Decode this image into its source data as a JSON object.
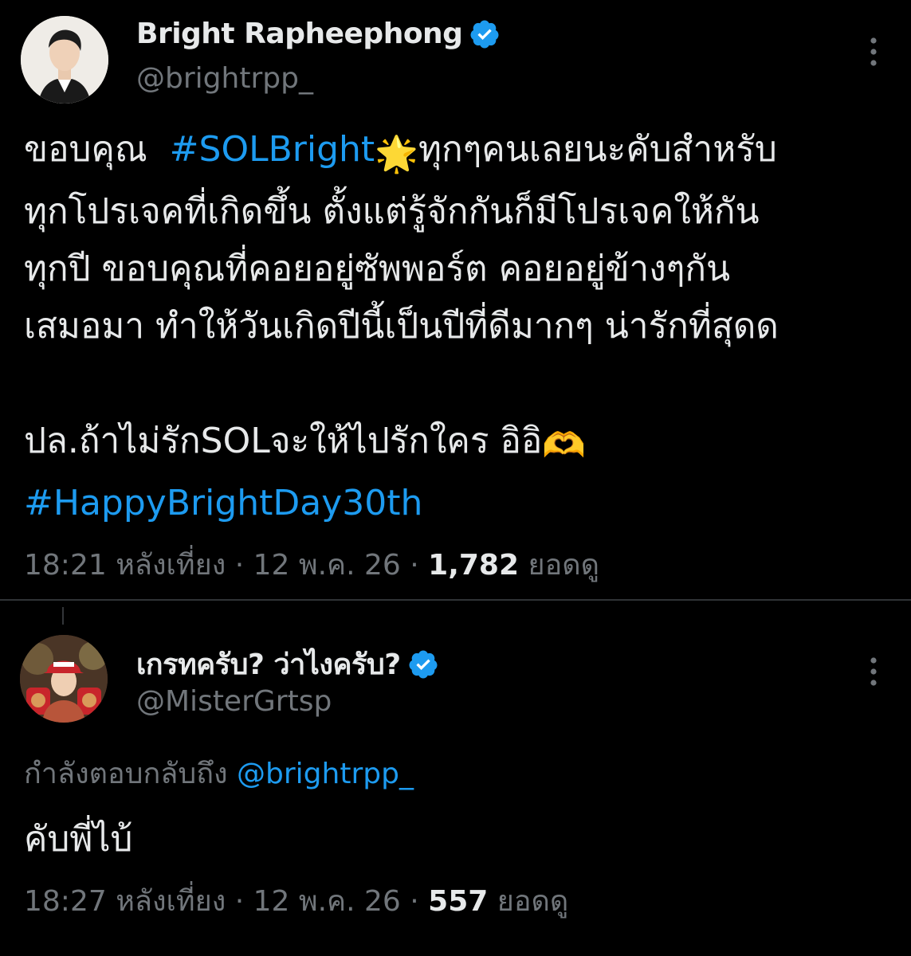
{
  "colors": {
    "background": "#000000",
    "text": "#e7e9ea",
    "secondary": "#71767b",
    "accent": "#1d9bf0",
    "divider": "#2f3336"
  },
  "main_tweet": {
    "display_name": "Bright Rapheephong",
    "handle": "@brightrpp_",
    "verified_icon": "verified-badge-icon",
    "more_icon": "more-vertical-icon",
    "text_line1_pre": "ขอบคุณ  ",
    "text_line1_hashtag": "#SOLBright",
    "text_line1_emoji": "🌟",
    "text_line1_post": "ทุกๆคนเลยนะคับสำหรับ",
    "text_line2": "ทุกโปรเจคที่เกิดขึ้น ตั้งแต่รู้จักกันก็มีโปรเจคให้กัน",
    "text_line3": "ทุกปี ขอบคุณที่คอยอยู่ซัพพอร์ต คอยอยู่ข้างๆกัน",
    "text_line4": "เสมอมา ทำให้วันเกิดปีนี้เป็นปีที่ดีมากๆ น่ารักที่สุดด",
    "text_line5_pre": "ปล.ถ้าไม่รักSOLจะให้ไปรักใคร อิอิ",
    "text_line5_emoji": "🫶",
    "text_line6_hashtag": "#HappyBrightDay30th",
    "time": "18:21 หลังเที่ยง",
    "separator": " · ",
    "date": "12 พ.ค. 26",
    "views_count": "1,782",
    "views_label": " ยอดดู"
  },
  "reply_tweet": {
    "display_name": "เกรทครับ? ว่าไงครับ?",
    "handle": "@MisterGrtsp",
    "verified_icon": "verified-badge-icon",
    "more_icon": "more-vertical-icon",
    "replying_to_label": "กำลังตอบกลับถึง ",
    "replying_to_handle": "@brightrpp_",
    "text": "คับพี่ไบ้",
    "time": "18:27 หลังเที่ยง",
    "separator": " · ",
    "date": "12 พ.ค. 26",
    "views_count": "557",
    "views_label": " ยอดดู"
  }
}
